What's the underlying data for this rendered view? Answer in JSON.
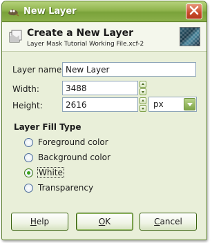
{
  "window": {
    "title": "New Layer"
  },
  "header": {
    "title": "Create a New Layer",
    "subtitle": "Layer Mask Tutorial Working File.xcf-2"
  },
  "form": {
    "layer_name_label": "Layer name:",
    "layer_name_value": "New Layer",
    "width_label": "Width:",
    "width_value": "3488",
    "height_label": "Height:",
    "height_value": "2616",
    "unit_value": "px"
  },
  "fill": {
    "title": "Layer Fill Type",
    "options": [
      {
        "label": "Foreground color",
        "checked": false
      },
      {
        "label": "Background color",
        "checked": false
      },
      {
        "label": "White",
        "checked": true
      },
      {
        "label": "Transparency",
        "checked": false
      }
    ]
  },
  "buttons": {
    "help": {
      "first": "H",
      "rest": "elp"
    },
    "ok": {
      "first": "O",
      "rest": "K"
    },
    "cancel": {
      "first": "C",
      "rest": "ancel"
    }
  },
  "colors": {
    "titlebar": "#8fb44d",
    "window_bg": "#e9efd9",
    "close": "#c94a2a",
    "radio_checked": "#3aa31a"
  },
  "icons": {
    "app": "gimp-icon",
    "close": "close-icon",
    "layer": "new-layer-icon",
    "thumbnail": "image-thumbnail"
  }
}
